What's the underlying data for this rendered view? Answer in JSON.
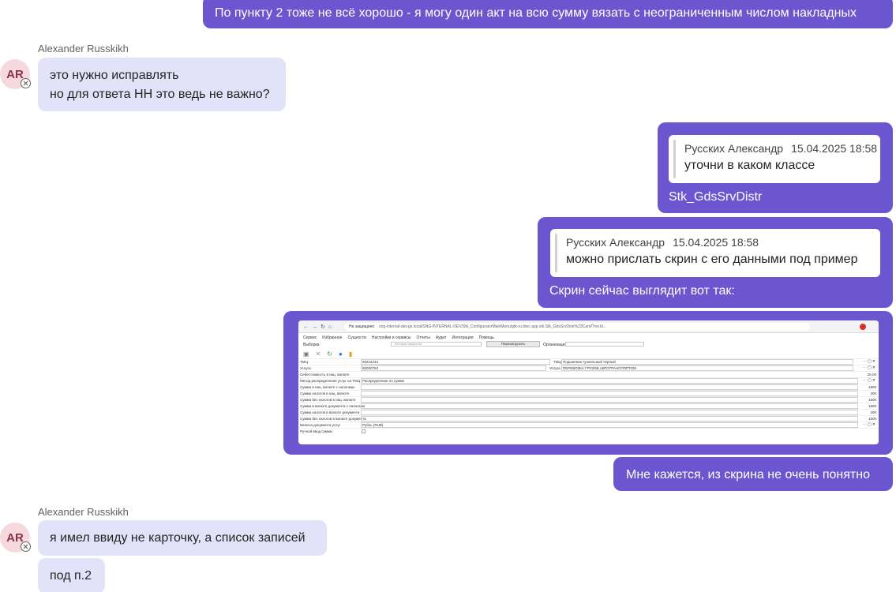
{
  "messages": {
    "m1": {
      "text": "По пункту 2 тоже не всё хорошо - я могу один акт на всю сумму вязать с неограниченным числом накладных"
    },
    "m2": {
      "sender": "Alexander Russkikh",
      "avatar": "AR",
      "line1": "это нужно исправлять",
      "line2": "но для ответа НН это ведь не важно?"
    },
    "m3": {
      "quote_author": "Русских Александр",
      "quote_time": "15.04.2025 18:58",
      "quote_text": "уточни в каком классе",
      "text": "Stk_GdsSrvDistr"
    },
    "m4": {
      "quote_author": "Русских Александр",
      "quote_time": "15.04.2025 18:58",
      "quote_text": "можно прислать скрин с его данными под пример",
      "text": "Скрин сейчас выглядит вот так:"
    },
    "m6": {
      "text": "Мне кажется, из скрина не очень понятно"
    },
    "m7": {
      "sender": "Alexander Russkikh",
      "avatar": "AR",
      "text": "я имел ввиду не карточку, а список записей"
    },
    "m8": {
      "text": "под п.2"
    }
  },
  "screenshot": {
    "security": "Не защищено",
    "url": "sng-internal-dev.gs.local/SNG-INTERNAL-DEV/Stk_ConfiguratorMainMenu/gtk-ru.btec.app.stk.Stk_GdsSrvDistr%23Card/?recId...",
    "menu": [
      "Сервис",
      "Избранное",
      "Сущности",
      "Настройки и сервисы",
      "Отчеты",
      "Аудит",
      "Интеграция",
      "Помощь"
    ],
    "filter_label": "Выборка",
    "filter_placeholder": "История запросов",
    "refresh_label": "Перезагрузить",
    "org_label": "Организация",
    "fields": [
      {
        "label": "ТМЦ",
        "value": "56224244",
        "extra_label": "ТМЦ",
        "extra_value": "Подшипник туннельный черный"
      },
      {
        "label": "Услуга",
        "value": "80000752",
        "extra_label": "Услуга",
        "extra_value": "ПЕРЕВОЗКА ГРУЗОВ АВТОТРАНСПОРТОМ"
      },
      {
        "label": "Себестоимость в нац. валюте",
        "number": "25,00"
      },
      {
        "label": "Метод распределения услуг на ТМЦ",
        "value": "Распределение по сумме"
      },
      {
        "label": "Сумма в нац. валюте с налогами",
        "number": "1800"
      },
      {
        "label": "Сумма налогов в нац. валюте",
        "number": "300"
      },
      {
        "label": "Сумма без налогов в нац. валюте",
        "number": "1500"
      },
      {
        "label": "Сумма в валюте документа с налогами",
        "number": "1800"
      },
      {
        "label": "Сумма налогов в валюте документа",
        "number": "300"
      },
      {
        "label": "Сумма без налогов в валюте документа",
        "number": "1500"
      },
      {
        "label": "Валюта документа услуг",
        "value": "Рубль (RUB)"
      },
      {
        "label": "Ручной ввод суммы"
      }
    ]
  }
}
